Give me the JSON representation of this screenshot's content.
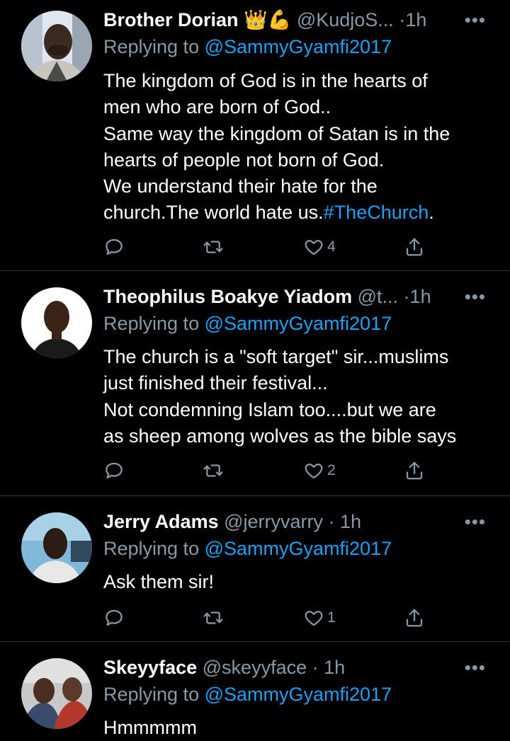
{
  "tweets": [
    {
      "name": "Brother Dorian",
      "name_emojis": "👑💪",
      "handle": "@KudjoS...",
      "time": "1h",
      "replying_prefix": "Replying to",
      "replying_to": "@SammyGyamfi2017",
      "lines": [
        "The kingdom of God is in the hearts of",
        "men who are born of God..",
        "Same way the kingdom of Satan is in the",
        "hearts of people not born of God.",
        "We understand their hate for the"
      ],
      "last_line_text": "church.The world hate us.",
      "hashtag": "#TheChurch",
      "last_line_end": ".",
      "likes": "4",
      "avatar_colors": [
        "#dfe6ef",
        "#3b2a20",
        "#c9c4be"
      ]
    },
    {
      "name": "Theophilus Boakye Yiadom",
      "handle": "@t...",
      "time": "1h",
      "replying_prefix": "Replying to",
      "replying_to": "@SammyGyamfi2017",
      "lines": [
        "The church is a \"soft target\" sir...muslims",
        "just finished their festival...",
        "Not condemning Islam too....but we are",
        "as sheep among wolves as the bible says"
      ],
      "likes": "2",
      "avatar_colors": [
        "#ffffff",
        "#3a2418",
        "#1a1a1a"
      ]
    },
    {
      "name": "Jerry Adams",
      "handle": "@jerryvarry",
      "time": "1h",
      "replying_prefix": "Replying to",
      "replying_to": "@SammyGyamfi2017",
      "lines": [
        "Ask them sir!"
      ],
      "likes": "1",
      "avatar_colors": [
        "#7fb8d8",
        "#2b1d14",
        "#e8e8e8"
      ]
    },
    {
      "name": "Skeyyface",
      "handle": "@skeyyface",
      "time": "1h",
      "replying_prefix": "Replying to",
      "replying_to": "@SammyGyamfi2017",
      "lines": [
        "Hmmmmm"
      ],
      "avatar_colors": [
        "#c8c8c8",
        "#4a2e22",
        "#b33a2a"
      ]
    }
  ],
  "colors": {
    "background": "#000000",
    "text": "#ffffff",
    "secondary": "#8899a6",
    "accent": "#1da1f2",
    "divider": "#2f3336"
  },
  "icons": [
    "reply-icon",
    "retweet-icon",
    "like-icon",
    "share-icon",
    "more-icon"
  ]
}
